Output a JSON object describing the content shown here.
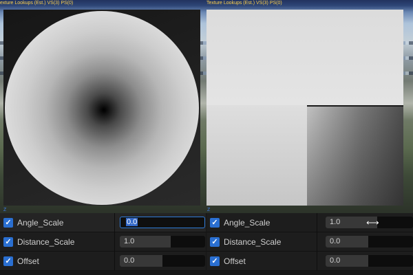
{
  "viewport": {
    "left_header": "exture Lookups (Est.) VS(3) PS(0)",
    "right_header": "Texture Lookups (Est.) VS(3) PS(0)",
    "axis_mark": "Z"
  },
  "details_left": {
    "properties": [
      {
        "label": "Angle_Scale",
        "value": "0.0",
        "checked": true,
        "editing": true,
        "fill": 0
      },
      {
        "label": "Distance_Scale",
        "value": "1.0",
        "checked": true,
        "editing": false,
        "fill": 1.0
      },
      {
        "label": "Offset",
        "value": "0.0",
        "checked": true,
        "editing": false,
        "fill": 0.45
      }
    ]
  },
  "details_right": {
    "properties": [
      {
        "label": "Angle_Scale",
        "value": "1.0",
        "checked": true,
        "editing": false,
        "fill": 1.0
      },
      {
        "label": "Distance_Scale",
        "value": "0.0",
        "checked": true,
        "editing": false,
        "fill": 0.45
      },
      {
        "label": "Offset",
        "value": "0.0",
        "checked": true,
        "editing": false,
        "fill": 0.45
      }
    ]
  },
  "icons": {
    "checkbox": "checkmark-icon",
    "cursor": "resize-horizontal-cursor-icon"
  },
  "colors": {
    "accent": "#2f7bd8",
    "header_text": "#ffd34f",
    "checkbox": "#2a6fd1"
  }
}
